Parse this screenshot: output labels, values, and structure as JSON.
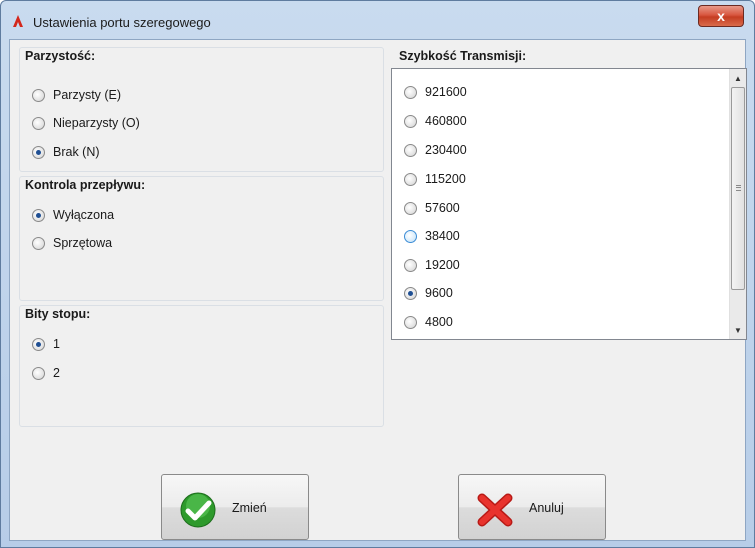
{
  "window": {
    "title": "Ustawienia portu szeregowego",
    "close_label": "x"
  },
  "parity": {
    "title": "Parzystość:",
    "options": [
      {
        "label": "Parzysty (E)",
        "checked": false
      },
      {
        "label": "Nieparzysty (O)",
        "checked": false
      },
      {
        "label": "Brak (N)",
        "checked": true
      }
    ]
  },
  "flow": {
    "title": "Kontrola przepływu:",
    "options": [
      {
        "label": "Wyłączona",
        "checked": true
      },
      {
        "label": "Sprzętowa",
        "checked": false
      }
    ]
  },
  "stop_bits": {
    "title": "Bity stopu:",
    "options": [
      {
        "label": "1",
        "checked": true
      },
      {
        "label": "2",
        "checked": false
      }
    ]
  },
  "baud": {
    "title": "Szybkość Transmisji:",
    "options": [
      {
        "label": "921600",
        "checked": false
      },
      {
        "label": "460800",
        "checked": false
      },
      {
        "label": "230400",
        "checked": false
      },
      {
        "label": "115200",
        "checked": false
      },
      {
        "label": "57600",
        "checked": false
      },
      {
        "label": "38400",
        "checked": false,
        "hover": true
      },
      {
        "label": "19200",
        "checked": false
      },
      {
        "label": "9600",
        "checked": true
      },
      {
        "label": "4800",
        "checked": false
      }
    ]
  },
  "buttons": {
    "change": {
      "label": "Zmień",
      "icon": "check-icon",
      "color": "#2e9a2c"
    },
    "cancel": {
      "label": "Anuluj",
      "icon": "x-icon",
      "color": "#d8231f"
    }
  }
}
